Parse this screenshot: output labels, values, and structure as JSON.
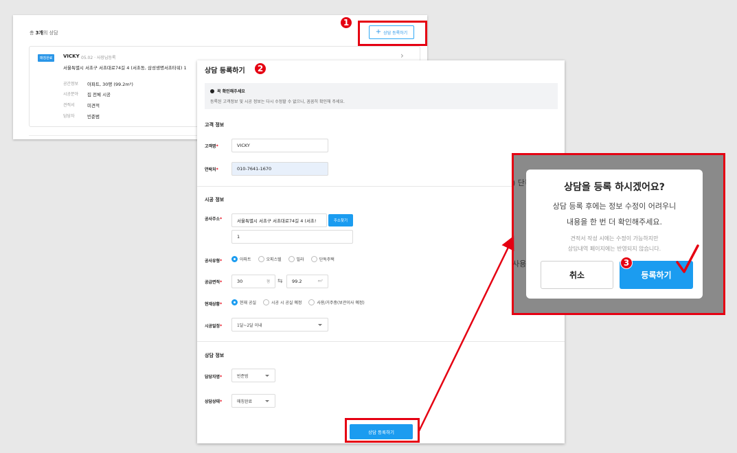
{
  "colors": {
    "accent": "#1b9cf0",
    "highlight": "#e50012",
    "badge": "#2a96e8"
  },
  "back_list": {
    "total_text": "총 3개의 상담",
    "total_prefix": "총 ",
    "total_count": "3개",
    "total_suffix": "의 상담",
    "add_button_label": "상담 등록하기",
    "card": {
      "badge": "매칭완료",
      "name": "VICKY",
      "meta": "05.02 · 사장님등록",
      "address": "서울특별시 서초구 서초대로74길 4 (서초동, 삼성생명서초타워) 1",
      "rows": [
        {
          "label": "공간정보",
          "value": "아파트, 30평 (99.2m²)"
        },
        {
          "label": "시공분야",
          "value": "집 전체 시공"
        },
        {
          "label": "견적서",
          "value": "미견적"
        },
        {
          "label": "담당자",
          "value": "빈준범"
        }
      ]
    }
  },
  "steps": [
    "1",
    "2",
    "3"
  ],
  "form": {
    "title": "상담 등록하기",
    "notice_title": "꼭 확인해주세요",
    "notice_text": "등록된 고객정보 및 시공 정보는 다시 수정할 수 없으니, 꼼꼼히 확인해 주세요.",
    "customer_section": "고객 정보",
    "name_label": "고객명",
    "name_value": "VICKY",
    "phone_label": "연락처",
    "phone_value": "010-7641-1670",
    "construction_section": "시공 정보",
    "address_label": "공사주소",
    "address_value": "서울특별시 서초구 서초대로74길 4 (서초!",
    "address_button": "주소찾기",
    "address_detail": "1",
    "type_label": "공사유형",
    "type_options": [
      "아파트",
      "오피스텔",
      "빌라",
      "단독주택"
    ],
    "area_label": "공급면적",
    "area_pyeong": "30",
    "area_pyeong_unit": "평",
    "area_m2": "99.2",
    "area_m2_unit": "m²",
    "status_label": "현재상황",
    "status_options": [
      "현재 공실",
      "시공 시 공실 예정",
      "사용/거주중(보관이사 예정)"
    ],
    "schedule_label": "시공일정",
    "schedule_value": "1달~2달 이내",
    "consult_section": "상담 정보",
    "manager_label": "담당자명",
    "manager_value": "빈준범",
    "state_label": "상담상태",
    "state_value": "매칭완료",
    "submit_label": "상담 등록하기"
  },
  "dialog": {
    "peek_text_1": ") 단독",
    "peek_text_2": "사용/",
    "title": "상담을 등록 하시겠어요?",
    "message_line1": "상담 등록 후에는 정보 수정이 어려우니",
    "message_line2": "내용을 한 번 더 확인해주세요.",
    "note_line1": "견적서 작성 시에는 수정이 가능하지만",
    "note_line2": "상담내역 페이지에는 반영되지 않습니다.",
    "cancel_label": "취소",
    "confirm_label": "등록하기"
  }
}
